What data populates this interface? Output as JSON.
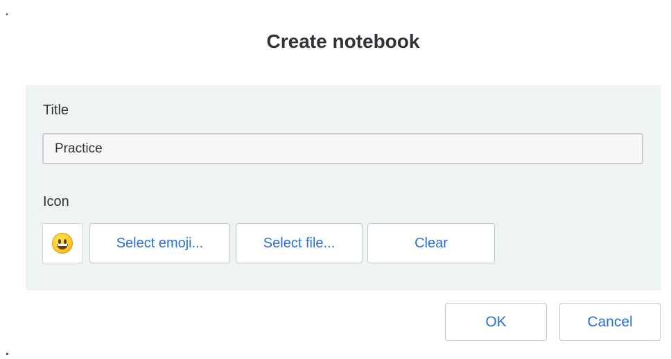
{
  "dialog": {
    "title": "Create notebook"
  },
  "form": {
    "title_label": "Title",
    "title_value": "Practice",
    "icon_label": "Icon",
    "selected_icon": "grinning-face-emoji",
    "select_emoji_label": "Select emoji...",
    "select_file_label": "Select file...",
    "clear_label": "Clear"
  },
  "actions": {
    "ok_label": "OK",
    "cancel_label": "Cancel"
  },
  "colors": {
    "accent": "#2a6fd6",
    "panel_background": "#eef3f3",
    "title_text": "#2f3338"
  }
}
